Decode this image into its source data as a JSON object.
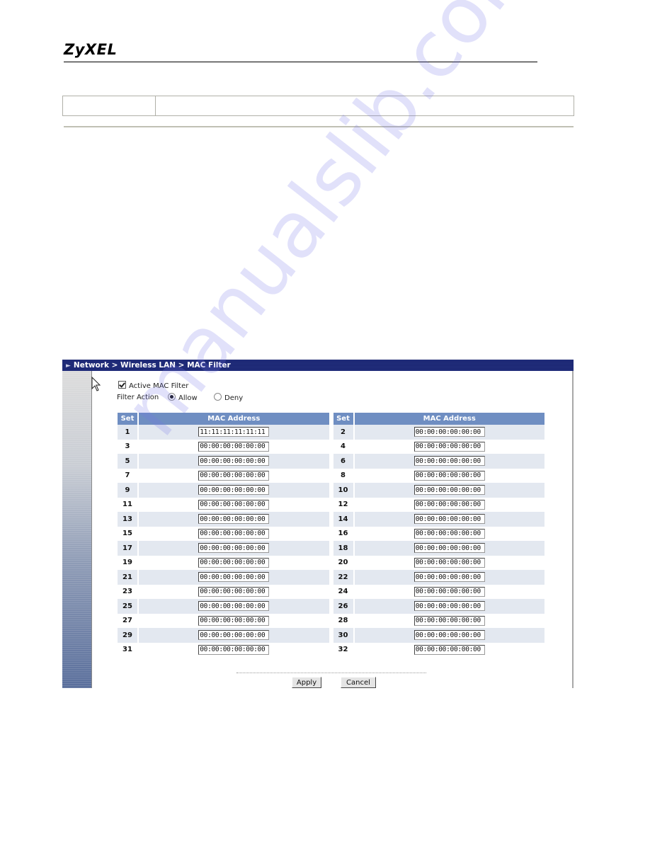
{
  "document": {
    "brand": "ZyXEL",
    "watermark": "manualslib.com"
  },
  "screenshot": {
    "breadcrumb": "Network > Wireless LAN > MAC Filter",
    "active_mac_filter": {
      "label": "Active MAC Filter",
      "checked": true
    },
    "filter_action": {
      "label": "Filter Action",
      "options": [
        {
          "label": "Allow",
          "selected": true
        },
        {
          "label": "Deny",
          "selected": false
        }
      ]
    },
    "table": {
      "headers": {
        "set": "Set",
        "mac": "MAC Address"
      },
      "rows": [
        {
          "left_set": "1",
          "left_mac": "11:11:11:11:11:11",
          "right_set": "2",
          "right_mac": "00:00:00:00:00:00"
        },
        {
          "left_set": "3",
          "left_mac": "00:00:00:00:00:00",
          "right_set": "4",
          "right_mac": "00:00:00:00:00:00"
        },
        {
          "left_set": "5",
          "left_mac": "00:00:00:00:00:00",
          "right_set": "6",
          "right_mac": "00:00:00:00:00:00"
        },
        {
          "left_set": "7",
          "left_mac": "00:00:00:00:00:00",
          "right_set": "8",
          "right_mac": "00:00:00:00:00:00"
        },
        {
          "left_set": "9",
          "left_mac": "00:00:00:00:00:00",
          "right_set": "10",
          "right_mac": "00:00:00:00:00:00"
        },
        {
          "left_set": "11",
          "left_mac": "00:00:00:00:00:00",
          "right_set": "12",
          "right_mac": "00:00:00:00:00:00"
        },
        {
          "left_set": "13",
          "left_mac": "00:00:00:00:00:00",
          "right_set": "14",
          "right_mac": "00:00:00:00:00:00"
        },
        {
          "left_set": "15",
          "left_mac": "00:00:00:00:00:00",
          "right_set": "16",
          "right_mac": "00:00:00:00:00:00"
        },
        {
          "left_set": "17",
          "left_mac": "00:00:00:00:00:00",
          "right_set": "18",
          "right_mac": "00:00:00:00:00:00"
        },
        {
          "left_set": "19",
          "left_mac": "00:00:00:00:00:00",
          "right_set": "20",
          "right_mac": "00:00:00:00:00:00"
        },
        {
          "left_set": "21",
          "left_mac": "00:00:00:00:00:00",
          "right_set": "22",
          "right_mac": "00:00:00:00:00:00"
        },
        {
          "left_set": "23",
          "left_mac": "00:00:00:00:00:00",
          "right_set": "24",
          "right_mac": "00:00:00:00:00:00"
        },
        {
          "left_set": "25",
          "left_mac": "00:00:00:00:00:00",
          "right_set": "26",
          "right_mac": "00:00:00:00:00:00"
        },
        {
          "left_set": "27",
          "left_mac": "00:00:00:00:00:00",
          "right_set": "28",
          "right_mac": "00:00:00:00:00:00"
        },
        {
          "left_set": "29",
          "left_mac": "00:00:00:00:00:00",
          "right_set": "30",
          "right_mac": "00:00:00:00:00:00"
        },
        {
          "left_set": "31",
          "left_mac": "00:00:00:00:00:00",
          "right_set": "32",
          "right_mac": "00:00:00:00:00:00"
        }
      ]
    },
    "buttons": {
      "apply": "Apply",
      "cancel": "Cancel"
    },
    "colors": {
      "breadcrumb_bg": "#1a2470",
      "table_header_bg": "#6f8ec2",
      "row_alt_bg": "#e3e8f0"
    }
  }
}
